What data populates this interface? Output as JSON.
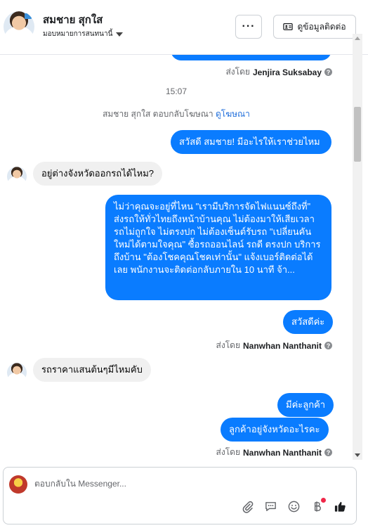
{
  "header": {
    "contact_name": "สมชาย สุกใส",
    "assignee_label": "มอบหมายการสนทนานี้",
    "more_label": "···",
    "info_label": "ดูข้อมูลติดต่อ"
  },
  "thread": {
    "sent_by_prefix": "ส่งโดย",
    "time_divider": "15:07",
    "ad_reply_text": "สมชาย สุกใส ตอบกลับโฆษณา",
    "ad_link": "ดูโฆษณา",
    "sender_1": "Jenjira Suksabay",
    "out_1": "สวัสดี สมชาย! มีอะไรให้เราช่วยไหม",
    "in_1": "อยู่ต่างจังหวัดออกรถได้ไหม?",
    "out_2": "ไม่ว่าคุณจะอยู่ที่ไหน \"เรามีบริการจัดไฟแนนซ์ถึงที่\" ส่งรถให้ทั่วไทยถึงหน้าบ้านคุณ ไม่ต้องมาให้เสียเวลา รถไม่ถูกใจ ไม่ตรงปก ไม่ต้องเซ็นต์รับรถ \"เปลี่ยนคันใหม่ได้ตามใจคุณ\" ซื้อรถออนไลน์ รถดี ตรงปก บริการถึงบ้าน \"ต้องโชคคุณโชคเท่านั้น\" แจ้งเบอร์ติดต่อได้เลย พนักงานจะติดต่อกลับภายใน 10 นาที จ้า...",
    "out_3": "สวัสดีค่ะ",
    "sender_2": "Nanwhan Nanthanit",
    "in_2": "รถราคาแสนต้นๆมีไหมคับ",
    "out_4": "มีค่ะลูกค้า",
    "out_5": "ลูกค้าอยู่จังหวัดอะไรคะ",
    "sender_3": "Nanwhan Nanthanit"
  },
  "composer": {
    "placeholder": "ตอบกลับใน Messenger..."
  },
  "colors": {
    "outgoing_bubble": "#0a7cff",
    "incoming_bubble": "#f0f0f0",
    "link": "#216fdb"
  },
  "icons": [
    "more-icon",
    "contact-card-icon",
    "chevron-down-icon",
    "help-icon",
    "attach-icon",
    "saved-reply-icon",
    "emoji-icon",
    "baht-icon",
    "like-icon"
  ]
}
